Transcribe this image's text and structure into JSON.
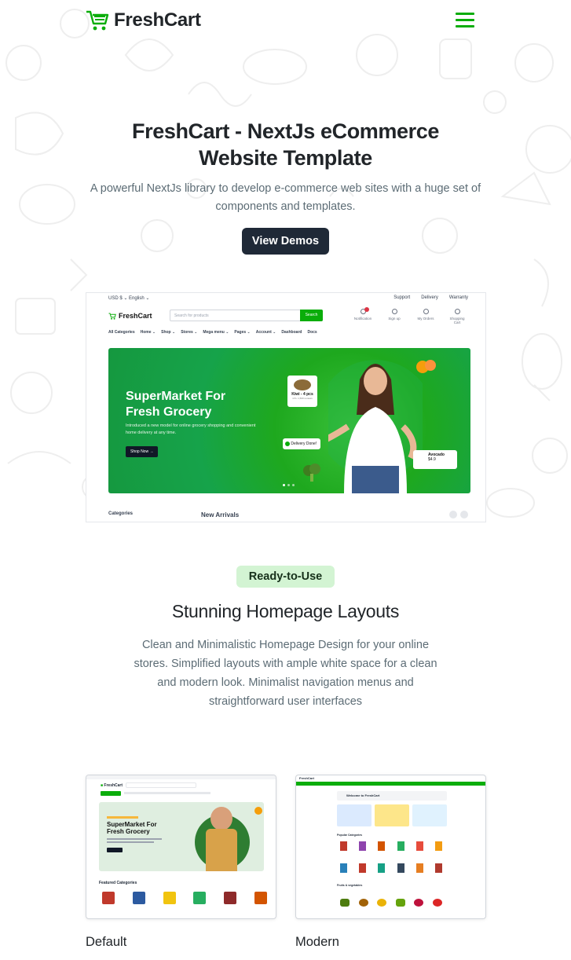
{
  "brand": {
    "name": "FreshCart",
    "accent": "#0aad0a"
  },
  "hero": {
    "title": "FreshCart - NextJs eCommerce Website Template",
    "subtitle": "A powerful NextJs library to develop e-commerce web sites with a huge set of components and templates.",
    "cta": "View Demos"
  },
  "preview": {
    "top_left": "USD $ ⌄   English ⌄",
    "top_links": [
      "Support",
      "Delivery",
      "Warranty"
    ],
    "logo": "FreshCart",
    "search_placeholder": "Search for products",
    "search_button": "Search",
    "icons": [
      {
        "label": "Notification",
        "icon": "bell-icon"
      },
      {
        "label": "Sign up",
        "icon": "user-icon"
      },
      {
        "label": "My Orders",
        "icon": "orders-icon"
      },
      {
        "label": "Shopping Cart",
        "icon": "cart-icon"
      }
    ],
    "nav": [
      "All Categories",
      "Home ⌄",
      "Shop ⌄",
      "Stores ⌄",
      "Mega menu ⌄",
      "Pages ⌄",
      "Account ⌄",
      "Dashboard",
      "Docs"
    ],
    "banner": {
      "title": "SuperMarket For Fresh Grocery",
      "text": "Introduced a new model for online grocery shopping and convenient home delivery at any time.",
      "button": "Shop Now →",
      "kiwi": "Kiwi - 4 pcs",
      "kiwi_sub": "4.8 • 1,500 reviews",
      "delivery": "Delivery Done!",
      "avocado": "Avocado",
      "avocado_price": "$4.9"
    },
    "categories_label": "Categories",
    "new_arrivals_label": "New Arrivals"
  },
  "section": {
    "pill": "Ready-to-Use",
    "title": "Stunning Homepage Layouts",
    "text": "Clean and Minimalistic Homepage Design for your online stores. Simplified layouts with ample white space for a clean and modern look. Minimalist navigation menus and straightforward user interfaces"
  },
  "layouts": [
    {
      "title": "Default",
      "banner_title": "SuperMarket For Fresh Grocery",
      "featured": "Featured Categories"
    },
    {
      "title": "Modern",
      "welcome": "Welcome to FreshCart",
      "popular": "Popular Categories",
      "fruits": "Fruits & vegetables"
    }
  ]
}
